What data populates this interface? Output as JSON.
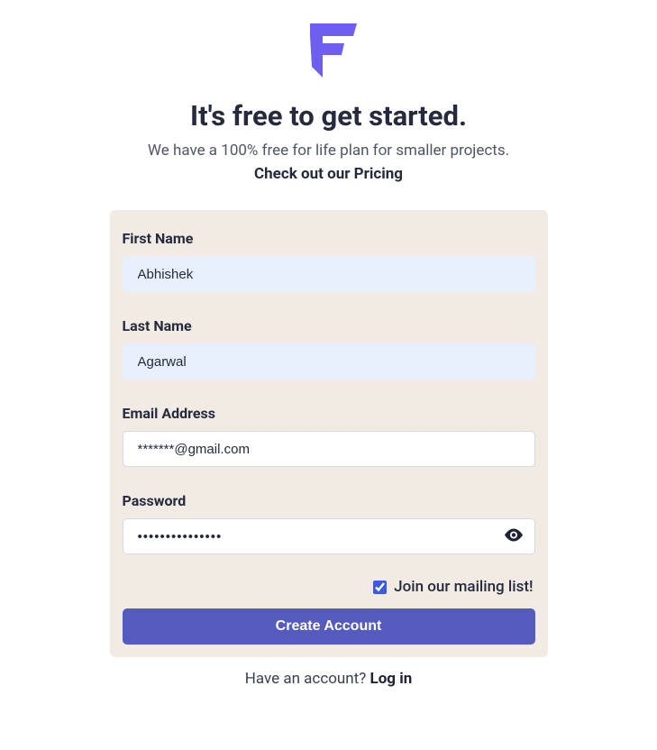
{
  "header": {
    "title": "It's free to get started.",
    "subtitle": "We have a 100% free for life plan for smaller projects.",
    "pricing_link": "Check out our Pricing"
  },
  "form": {
    "first_name": {
      "label": "First Name",
      "value": "Abhishek"
    },
    "last_name": {
      "label": "Last Name",
      "value": "Agarwal"
    },
    "email": {
      "label": "Email Address",
      "value": "*******@gmail.com"
    },
    "password": {
      "label": "Password",
      "value": "•••••••••••••••"
    },
    "mailing_list": {
      "label": "Join our mailing list!",
      "checked": true
    },
    "submit_label": "Create Account"
  },
  "footer": {
    "prompt": "Have an account? ",
    "login_label": "Log in"
  },
  "colors": {
    "brand": "#6e5ff0",
    "button": "#555abf",
    "card": "#f1ebe4",
    "autofill": "#e8f0fe"
  }
}
